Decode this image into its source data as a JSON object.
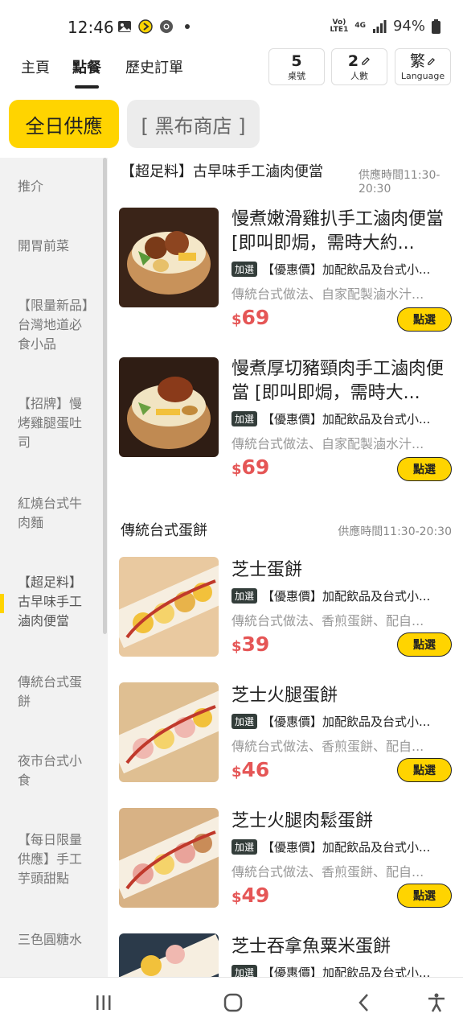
{
  "status_bar": {
    "time": "12:46",
    "network_label": "Vo)\nLTE1",
    "network_gen": "4G",
    "battery": "94%"
  },
  "top_nav": {
    "tabs": [
      "主頁",
      "點餐",
      "歷史訂單"
    ],
    "active_tab": "點餐",
    "table": {
      "value": "5",
      "label": "桌號"
    },
    "people": {
      "value": "2",
      "label": "人數"
    },
    "language": {
      "value": "繁",
      "label": "Language"
    }
  },
  "menu_tabs": {
    "active": "全日供應",
    "other": "[ 黑布商店 ]"
  },
  "sidebar": {
    "items": [
      "推介",
      "開胃前菜",
      "【限量新品】台灣地道必食小品",
      "【招牌】慢烤雞腿蛋吐司",
      "紅燒台式牛肉麵",
      "【超足料】古早味手工滷肉便當",
      "傳統台式蛋餅",
      "夜市台式小食",
      "【每日限量供應】手工芋頭甜點",
      "三色圓糖水"
    ]
  },
  "sections": [
    {
      "title": "【超足料】古早味手工滷肉便當",
      "time": "供應時間11:30-20:30",
      "items": [
        {
          "name": "慢煮嫩滑雞扒手工滷肉便當 [即叫即焗，需時大約...",
          "promo_tag": "加選",
          "promo_text": "【優惠價】加配飲品及台式小...",
          "desc": "傳統台式做法、自家配製滷水汁...",
          "currency": "$",
          "price": "69",
          "button": "點選"
        },
        {
          "name": "慢煮厚切豬頸肉手工滷肉便當 [即叫即焗，需時大...",
          "promo_tag": "加選",
          "promo_text": "【優惠價】加配飲品及台式小...",
          "desc": "傳統台式做法、自家配製滷水汁...",
          "currency": "$",
          "price": "69",
          "button": "點選"
        }
      ]
    },
    {
      "title": "傳統台式蛋餅",
      "time": "供應時間11:30-20:30",
      "items": [
        {
          "name": "芝士蛋餅",
          "promo_tag": "加選",
          "promo_text": "【優惠價】加配飲品及台式小...",
          "desc": "傳統台式做法、香煎蛋餅、配自...",
          "currency": "$",
          "price": "39",
          "button": "點選"
        },
        {
          "name": "芝士火腿蛋餅",
          "promo_tag": "加選",
          "promo_text": "【優惠價】加配飲品及台式小...",
          "desc": "傳統台式做法、香煎蛋餅、配自...",
          "currency": "$",
          "price": "46",
          "button": "點選"
        },
        {
          "name": "芝士火腿肉鬆蛋餅",
          "promo_tag": "加選",
          "promo_text": "【優惠價】加配飲品及台式小...",
          "desc": "傳統台式做法、香煎蛋餅、配自...",
          "currency": "$",
          "price": "49",
          "button": "點選"
        },
        {
          "name": "芝士吞拿魚粟米蛋餅",
          "promo_tag": "加選",
          "promo_text": "【優惠價】加配飲品及台式小...",
          "desc": "",
          "currency": "$",
          "price": "",
          "button": ""
        }
      ]
    }
  ],
  "colors": {
    "accent_yellow": "#ffd400",
    "price_red": "#e55656",
    "tag_dark": "#333d3a"
  }
}
